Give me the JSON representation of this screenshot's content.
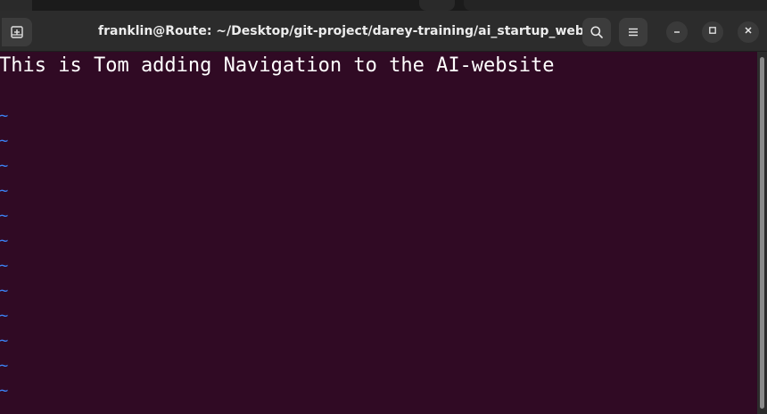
{
  "window": {
    "title": "franklin@Route: ~/Desktop/git-project/darey-training/ai_startup_website"
  },
  "header": {
    "new_tab_icon": "new-tab-icon",
    "search_icon": "search-icon",
    "menu_icon": "hamburger-menu-icon",
    "minimize_icon": "minimize-icon",
    "maximize_icon": "maximize-icon",
    "close_icon": "close-icon"
  },
  "editor": {
    "lines": [
      "This is Tom adding Navigation to the AI-website"
    ],
    "empty_line_marker": "~"
  },
  "colors": {
    "terminal_background": "#300a24",
    "text": "#ffffff",
    "tilde": "#3b83f7",
    "headerbar": "#2c2c2c"
  }
}
